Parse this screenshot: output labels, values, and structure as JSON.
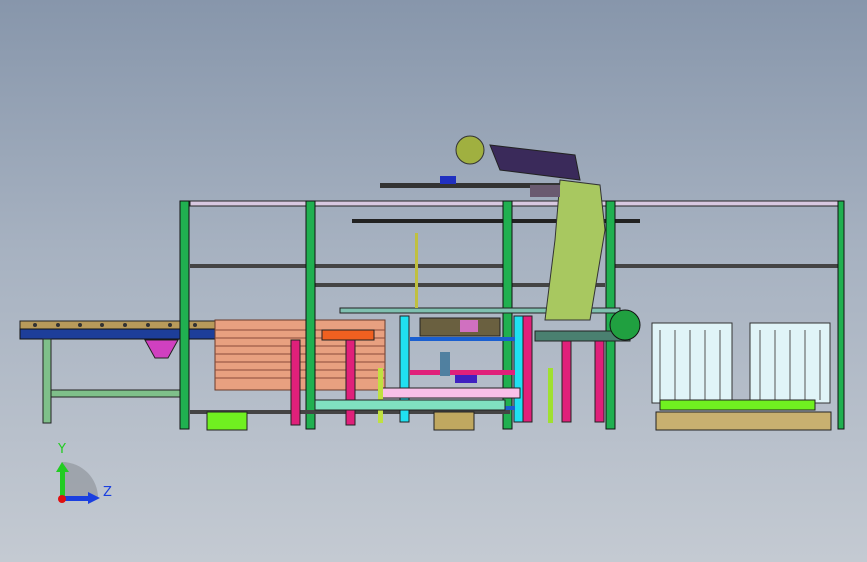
{
  "viewport": {
    "background_top": "#8796ab",
    "background_bottom": "#c4cad2"
  },
  "triad": {
    "y_label": "Y",
    "z_label": "Z",
    "y_color": "#22cc22",
    "z_color": "#1a3fe0",
    "x_color": "#e01010"
  }
}
